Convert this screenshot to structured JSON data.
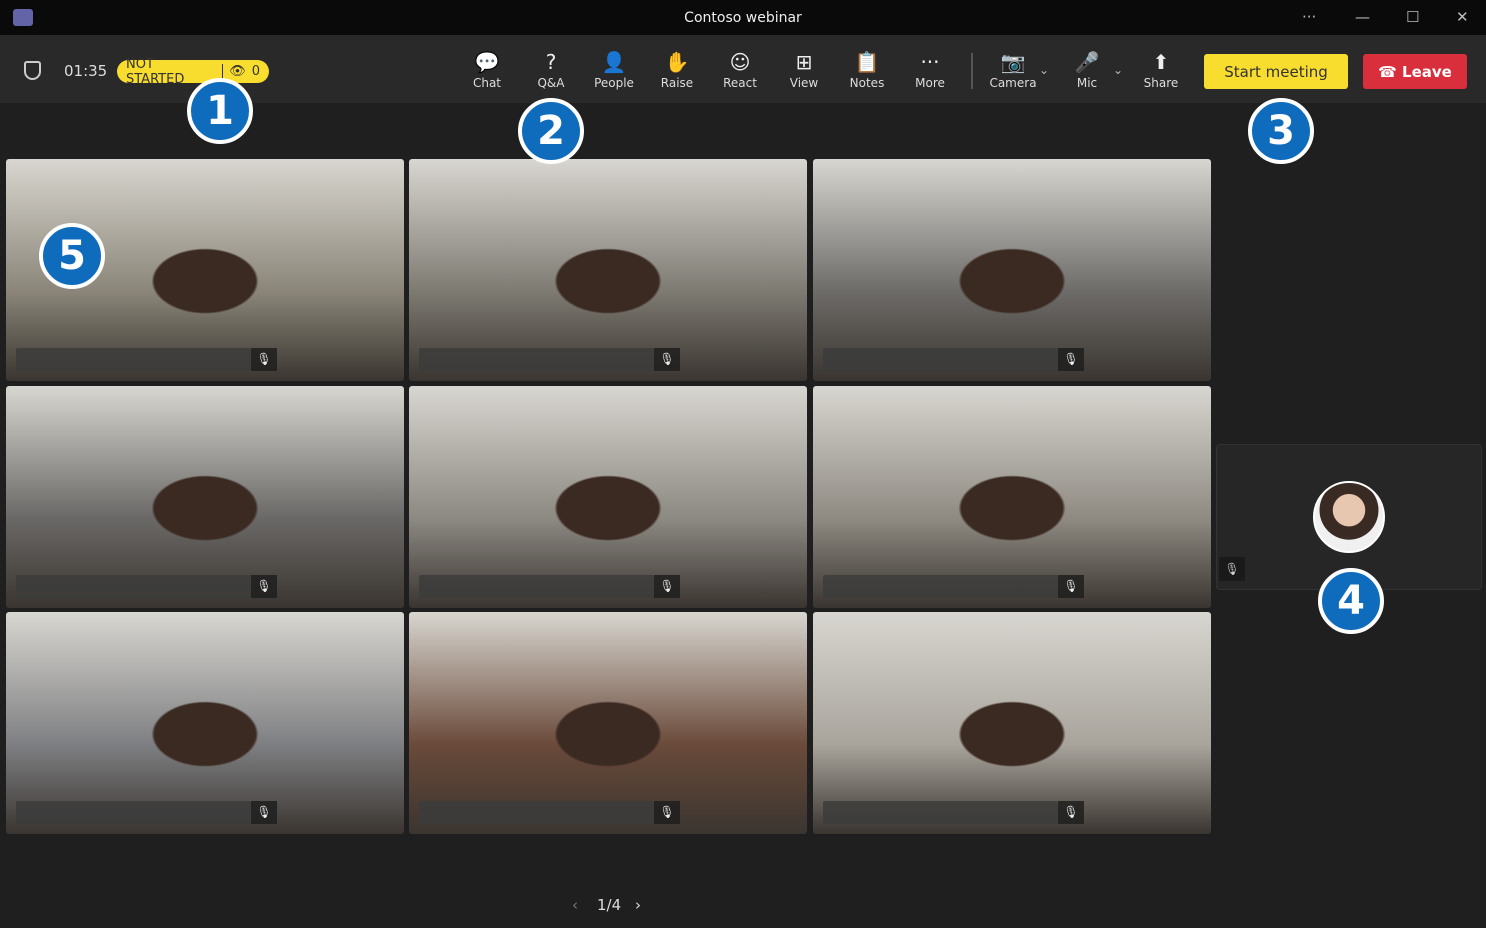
{
  "window": {
    "title": "Contoso webinar",
    "more": "···",
    "minimize": "—",
    "maximize": "☐",
    "close": "✕"
  },
  "meeting": {
    "timer": "01:35",
    "status": "NOT STARTED",
    "viewers": "0"
  },
  "toolbar": [
    {
      "label": "Chat",
      "icon": "chat-icon",
      "glyph": "💬"
    },
    {
      "label": "Q&A",
      "icon": "qa-icon",
      "glyph": "?"
    },
    {
      "label": "People",
      "icon": "people-icon",
      "glyph": "👤"
    },
    {
      "label": "Raise",
      "icon": "hand-icon",
      "glyph": "✋"
    },
    {
      "label": "React",
      "icon": "smile-icon",
      "glyph": "☺"
    },
    {
      "label": "View",
      "icon": "grid-icon",
      "glyph": "⊞"
    },
    {
      "label": "Notes",
      "icon": "notes-icon",
      "glyph": "📋"
    },
    {
      "label": "More",
      "icon": "more-icon",
      "glyph": "···"
    },
    {
      "label": "Camera",
      "icon": "camera-off-icon",
      "glyph": "📷"
    },
    {
      "label": "Mic",
      "icon": "mic-icon",
      "glyph": "🎤"
    },
    {
      "label": "Share",
      "icon": "share-icon",
      "glyph": "⬆"
    }
  ],
  "actions": {
    "start": "Start meeting",
    "leave": "Leave"
  },
  "colors": {
    "accent_yellow": "#f8dc2e",
    "leave_red": "#d92e3b",
    "callout_blue": "#0f6cbd"
  },
  "tiles": [
    {
      "c": "#8a8578"
    },
    {
      "c": "#7d7a72"
    },
    {
      "c": "#6d6b68"
    },
    {
      "c": "#6a6866"
    },
    {
      "c": "#8c8882"
    },
    {
      "c": "#8e8a82"
    },
    {
      "c": "#7e7f82"
    },
    {
      "c": "#6a4a3a"
    },
    {
      "c": "#a8a49c"
    }
  ],
  "pager": {
    "prev": "‹",
    "page": "1/4",
    "next": "›"
  },
  "callouts": [
    "1",
    "2",
    "3",
    "4",
    "5"
  ]
}
